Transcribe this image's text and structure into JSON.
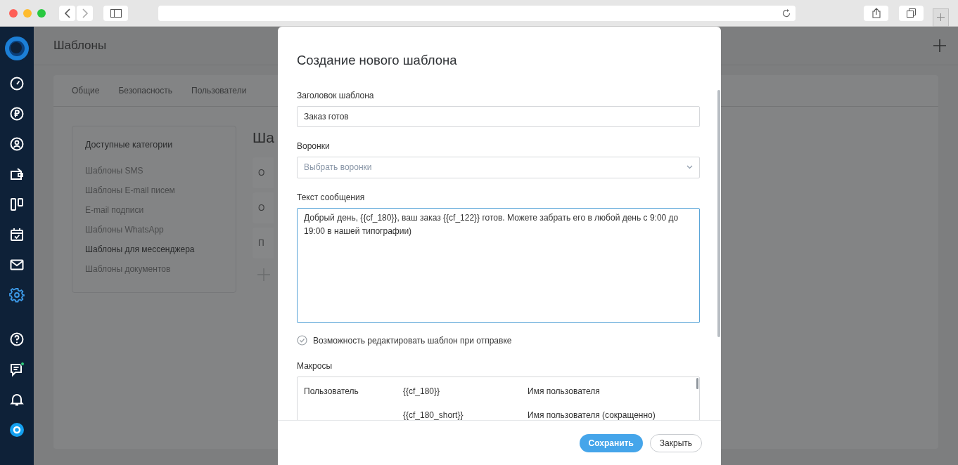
{
  "sidebar": {
    "items": [
      {
        "kind": "dashboard",
        "selected": false
      },
      {
        "kind": "finance",
        "selected": false
      },
      {
        "kind": "contacts",
        "selected": false
      },
      {
        "kind": "deals",
        "selected": false
      },
      {
        "kind": "boards",
        "selected": false
      },
      {
        "kind": "calendar",
        "selected": false
      },
      {
        "kind": "mail",
        "selected": false
      },
      {
        "kind": "settings",
        "selected": true
      }
    ],
    "bottom_items": [
      {
        "kind": "help",
        "unread": false
      },
      {
        "kind": "chat",
        "unread": true
      },
      {
        "kind": "bell",
        "unread": false
      },
      {
        "kind": "support",
        "unread": false
      }
    ]
  },
  "page": {
    "title": "Шаблоны"
  },
  "tabs": [
    {
      "label": "Общие"
    },
    {
      "label": "Безопасность"
    },
    {
      "label": "Пользователи"
    }
  ],
  "categories": {
    "title": "Доступные категории",
    "items": [
      {
        "label": "Шаблоны SMS",
        "selected": false
      },
      {
        "label": "Шаблоны E-mail писем",
        "selected": false
      },
      {
        "label": "E-mail подписи",
        "selected": false
      },
      {
        "label": "Шаблоны WhatsApp",
        "selected": false
      },
      {
        "label": "Шаблоны для мессенджера",
        "selected": true
      },
      {
        "label": "Шаблоны документов",
        "selected": false
      }
    ]
  },
  "content": {
    "heading": "Ша",
    "cards": [
      "О",
      "О",
      "П"
    ]
  },
  "modal": {
    "title": "Создание нового шаблона",
    "template_title": {
      "label": "Заголовок шаблона",
      "value": "Заказ готов"
    },
    "funnels": {
      "label": "Воронки",
      "placeholder": "Выбрать воронки"
    },
    "message": {
      "label": "Текст сообщения",
      "value": "Добрый день, {{cf_180}}, ваш заказ {{cf_122}} готов. Можете забрать его в любой день с 9:00 до 19:00 в нашей типографии)"
    },
    "editable_option": {
      "label": "Возможность редактировать шаблон при отправке",
      "checked": true
    },
    "macros": {
      "label": "Макросы",
      "rows": [
        {
          "group": "Пользователь",
          "code": "{{cf_180}}",
          "description": "Имя пользователя"
        },
        {
          "code": "{{cf_180_short}}",
          "description": "Имя пользователя (сокращенно)"
        }
      ]
    },
    "buttons": {
      "save": "Сохранить",
      "close": "Закрыть"
    }
  }
}
